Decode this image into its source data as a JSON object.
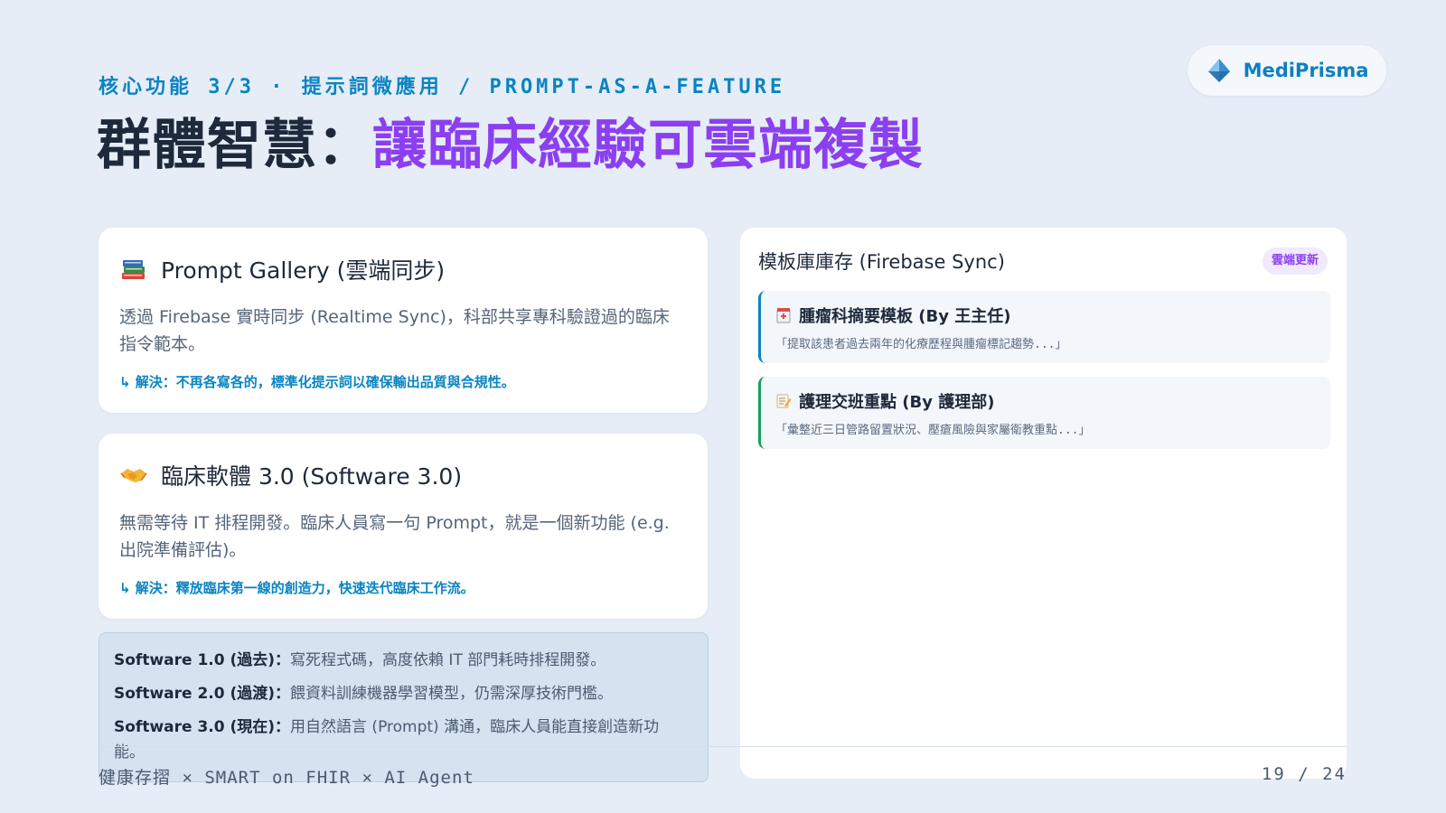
{
  "header": {
    "kicker": "核心功能 3/3 · 提示詞微應用 / PROMPT-AS-A-FEATURE",
    "title_part1": "群體智慧：",
    "title_part2": "讓臨床經驗可雲端複製"
  },
  "brand": {
    "name": "MediPrisma",
    "icon": "prism-logo-icon"
  },
  "cards": [
    {
      "icon": "books-icon",
      "title": "Prompt Gallery (雲端同步)",
      "body": "透過 Firebase 實時同步 (Realtime Sync)，科部共享專科驗證過的臨床指令範本。",
      "solution": "↳ 解決：不再各寫各的，標準化提示詞以確保輸出品質與合規性。"
    },
    {
      "icon": "handshake-icon",
      "title": "臨床軟體 3.0 (Software 3.0)",
      "body": "無需等待 IT 排程開發。臨床人員寫一句 Prompt，就是一個新功能 (e.g. 出院準備評估)。",
      "solution": "↳ 解決：釋放臨床第一線的創造力，快速迭代臨床工作流。"
    }
  ],
  "comparison": [
    {
      "label": "Software 1.0 (過去)：",
      "text": "寫死程式碼，高度依賴 IT 部門耗時排程開發。"
    },
    {
      "label": "Software 2.0 (過渡)：",
      "text": "餵資料訓練機器學習模型，仍需深厚技術門檻。"
    },
    {
      "label": "Software 3.0 (現在)：",
      "text": "用自然語言 (Prompt) 溝通，臨床人員能直接創造新功能。"
    }
  ],
  "panel": {
    "title": "模板庫庫存 (Firebase Sync)",
    "badge": "雲端更新",
    "templates": [
      {
        "icon": "hospital-icon",
        "title": "腫瘤科摘要模板 (By 王主任)",
        "quote": "「提取該患者過去兩年的化療歷程與腫瘤標記趨勢...」",
        "accent": "#0a84c2"
      },
      {
        "icon": "memo-icon",
        "title": "護理交班重點 (By 護理部)",
        "quote": "「彙整近三日管路留置狀況、壓瘡風險與家屬衛教重點...」",
        "accent": "#17a05d"
      }
    ]
  },
  "footer": {
    "left": "健康存摺 × SMART on FHIR × AI Agent",
    "page": "19 / 24"
  },
  "colors": {
    "background": "#e6edf6",
    "accent_blue": "#0a84c2",
    "accent_purple": "#8b3ff0",
    "text_dark": "#1e293b"
  }
}
